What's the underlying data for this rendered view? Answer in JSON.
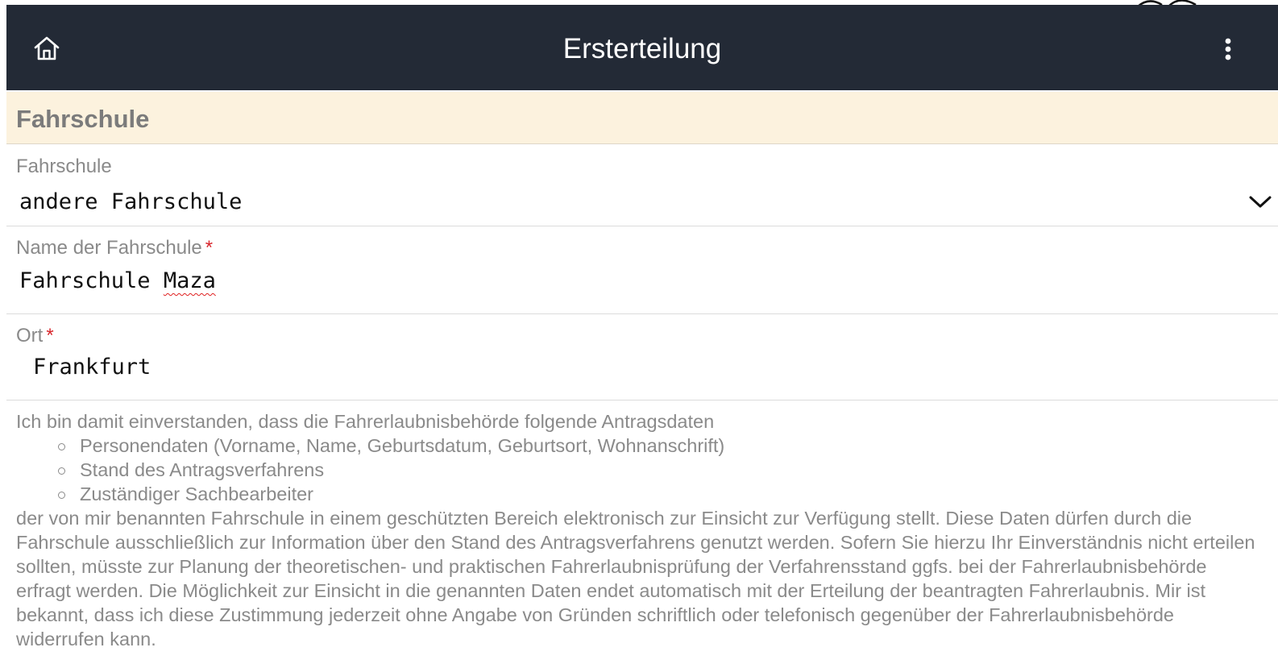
{
  "header": {
    "title": "Ersterteilung",
    "home_icon": "home-icon",
    "menu_icon": "more-vertical-icon"
  },
  "section": {
    "title": "Fahrschule"
  },
  "fields": {
    "fahrschule": {
      "label": "Fahrschule",
      "value": "andere Fahrschule",
      "icon": "chevron-down-icon"
    },
    "name": {
      "label": "Name der Fahrschule",
      "required_mark": "*",
      "value_word1": "Fahrschule",
      "value_word2": "Maza"
    },
    "ort": {
      "label": "Ort",
      "required_mark": "*",
      "value": "Frankfurt"
    }
  },
  "consent": {
    "intro": "Ich bin damit einverstanden, dass die Fahrerlaubnisbehörde folgende Antragsdaten",
    "items": [
      "Personendaten (Vorname, Name, Geburtsdatum, Geburtsort, Wohnanschrift)",
      "Stand des Antragsverfahrens",
      "Zuständiger Sachbearbeiter"
    ],
    "body": "der von mir benannten Fahrschule in einem geschützten Bereich elektronisch zur Einsicht zur Verfügung stellt. Diese Daten dürfen durch die Fahrschule ausschließlich zur Information über den Stand des Antragsverfahrens genutzt werden. Sofern Sie hierzu Ihr Einverständnis nicht erteilen sollten, müsste zur Planung der theoretischen- und praktischen Fahrerlaubnisprüfung der Verfahrensstand ggfs. bei der Fahrerlaubnisbehörde erfragt werden. Die Möglichkeit zur Einsicht in die genannten Daten endet automatisch mit der Erteilung der beantragten Fahrerlaubnis. Mir ist bekannt, dass ich diese Zustimmung jederzeit ohne Angabe von Gründen schriftlich oder telefonisch gegenüber der Fahrerlaubnisbehörde widerrufen kann."
  },
  "colors": {
    "header_bg": "#232a36",
    "section_bg": "#fcf2de",
    "required": "#d8262c",
    "muted_text": "#8a8a8a"
  }
}
